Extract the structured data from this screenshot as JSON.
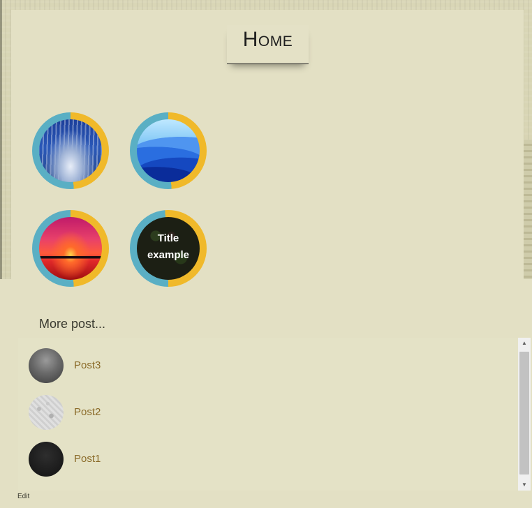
{
  "header": {
    "title": "Home"
  },
  "featured": [
    {
      "image": "frosted-forest"
    },
    {
      "image": "blue-mountains"
    },
    {
      "image": "red-sunset"
    },
    {
      "image": "dark-leaves",
      "caption_line1": "Title",
      "caption_line2": "example"
    }
  ],
  "more": {
    "heading": "More post...",
    "posts": [
      {
        "title": "Post3",
        "thumb": "gray-sphere"
      },
      {
        "title": "Post2",
        "thumb": "gray-marble"
      },
      {
        "title": "Post1",
        "thumb": "black-texture"
      }
    ]
  },
  "footer": {
    "edit_label": "Edit"
  },
  "colors": {
    "ring_blue": "#5aafc4",
    "ring_gold": "#f0b92a",
    "post_link": "#8a6a28",
    "background": "#e3e0c4"
  }
}
